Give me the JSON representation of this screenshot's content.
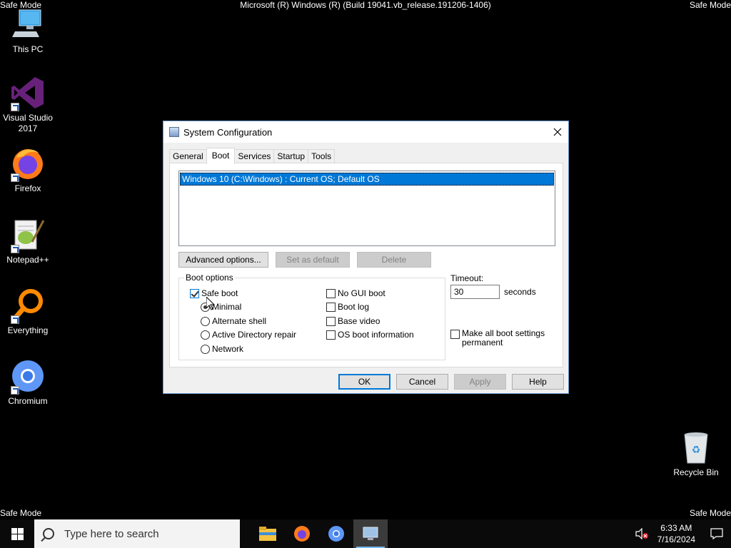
{
  "desktop": {
    "safe_mode_label": "Safe Mode",
    "build_text": "Microsoft (R) Windows (R) (Build 19041.vb_release.191206-1406)",
    "icons": [
      {
        "label": "This PC"
      },
      {
        "label": "Visual Studio 2017"
      },
      {
        "label": "Firefox"
      },
      {
        "label": "Notepad++"
      },
      {
        "label": "Everything"
      },
      {
        "label": "Chromium"
      },
      {
        "label": "Recycle Bin"
      }
    ]
  },
  "dialog": {
    "title": "System Configuration",
    "tabs": [
      "General",
      "Boot",
      "Services",
      "Startup",
      "Tools"
    ],
    "active_tab": "Boot",
    "os_list": [
      "Windows 10 (C:\\Windows) : Current OS; Default OS"
    ],
    "advanced_options_label": "Advanced options...",
    "set_default_label": "Set as default",
    "delete_label": "Delete",
    "boot_options_label": "Boot options",
    "safe_boot": {
      "label": "Safe boot",
      "checked": true
    },
    "radios": [
      {
        "label": "Minimal",
        "checked": true
      },
      {
        "label": "Alternate shell",
        "checked": false
      },
      {
        "label": "Active Directory repair",
        "checked": false
      },
      {
        "label": "Network",
        "checked": false
      }
    ],
    "checkboxes": [
      {
        "label": "No GUI boot",
        "checked": false
      },
      {
        "label": "Boot log",
        "checked": false
      },
      {
        "label": "Base video",
        "checked": false
      },
      {
        "label": "OS boot information",
        "checked": false
      }
    ],
    "timeout_label": "Timeout:",
    "timeout_value": "30",
    "seconds_label": "seconds",
    "make_permanent_label_1": "Make all boot settings",
    "make_permanent_label_2": "permanent",
    "ok_label": "OK",
    "cancel_label": "Cancel",
    "apply_label": "Apply",
    "help_label": "Help"
  },
  "taskbar": {
    "search_placeholder": "Type here to search",
    "time": "6:33 AM",
    "date": "7/16/2024"
  },
  "colors": {
    "accent": "#0078d7",
    "desktop_bg": "#000000"
  }
}
